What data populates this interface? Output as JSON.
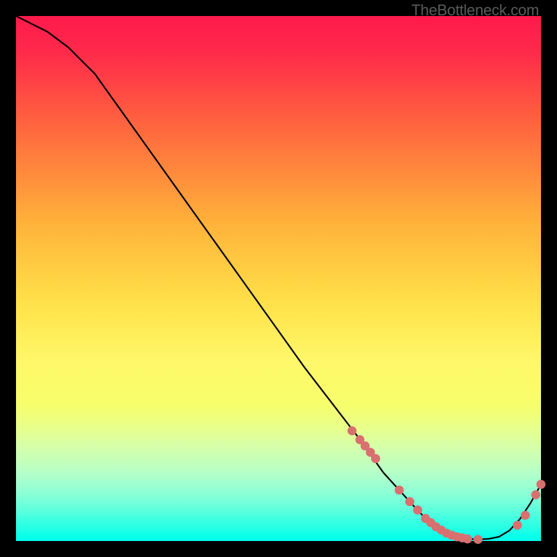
{
  "attribution": "TheBottleneck.com",
  "curve_label": "",
  "chart_data": {
    "type": "line",
    "title": "",
    "xlabel": "",
    "ylabel": "",
    "xlim": [
      0,
      100
    ],
    "ylim": [
      0,
      100
    ],
    "x": [
      0,
      3,
      6,
      10,
      15,
      20,
      25,
      30,
      35,
      40,
      45,
      50,
      55,
      60,
      65,
      70,
      72,
      74,
      76,
      78,
      80,
      82,
      84,
      86,
      88,
      90,
      92,
      94,
      96,
      98,
      100
    ],
    "values": [
      100,
      98.5,
      97,
      94,
      89,
      82,
      75,
      68,
      61,
      54,
      47,
      40,
      33,
      26.5,
      20,
      13,
      10.8,
      8.6,
      6.4,
      4.3,
      2.7,
      1.5,
      0.8,
      0.4,
      0.3,
      0.4,
      0.8,
      2.0,
      4.2,
      7.2,
      10.8
    ],
    "dots_x": [
      64,
      65.5,
      66.5,
      67.5,
      68.5,
      73,
      75,
      76.5,
      78,
      79,
      80,
      81,
      82,
      83,
      84,
      85,
      86,
      88,
      95.5,
      97,
      99,
      100
    ],
    "dots_y": [
      21,
      19.3,
      18.1,
      16.9,
      15.7,
      9.7,
      7.5,
      5.9,
      4.3,
      3.5,
      2.7,
      2.1,
      1.5,
      1.1,
      0.8,
      0.6,
      0.4,
      0.3,
      3.0,
      4.9,
      8.8,
      10.8
    ],
    "colors": {
      "dot": "#d87070",
      "line": "#000000"
    },
    "label_pos": {
      "x": 82,
      "y": 1.3
    }
  }
}
